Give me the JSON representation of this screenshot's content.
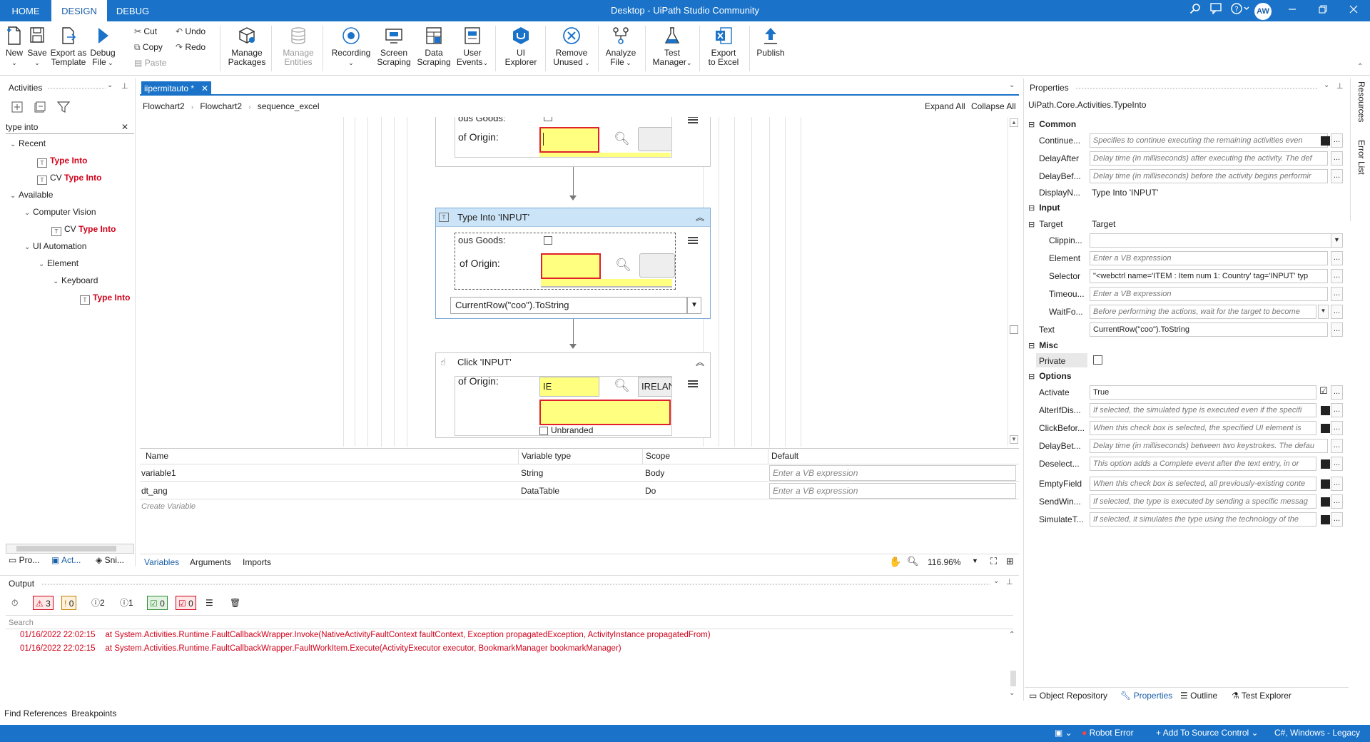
{
  "app": {
    "title": "Desktop - UiPath Studio Community",
    "tabs": [
      "HOME",
      "DESIGN",
      "DEBUG"
    ],
    "user_initials": "AW"
  },
  "ribbon": {
    "new": "New",
    "save": "Save",
    "export_template_1": "Export as",
    "export_template_2": "Template",
    "debug_1": "Debug",
    "debug_2": "File",
    "cut": "Cut",
    "copy": "Copy",
    "paste": "Paste",
    "undo": "Undo",
    "redo": "Redo",
    "manage_packages_1": "Manage",
    "manage_packages_2": "Packages",
    "manage_entities_1": "Manage",
    "manage_entities_2": "Entities",
    "recording": "Recording",
    "screen_scraping_1": "Screen",
    "screen_scraping_2": "Scraping",
    "data_scraping_1": "Data",
    "data_scraping_2": "Scraping",
    "user_events_1": "User",
    "user_events_2": "Events",
    "ui_explorer_1": "UI",
    "ui_explorer_2": "Explorer",
    "remove_unused_1": "Remove",
    "remove_unused_2": "Unused",
    "analyze_file_1": "Analyze",
    "analyze_file_2": "File",
    "test_manager_1": "Test",
    "test_manager_2": "Manager",
    "export_excel_1": "Export",
    "export_excel_2": "to Excel",
    "publish": "Publish"
  },
  "activities": {
    "title": "Activities",
    "search_value": "type into",
    "recent": "Recent",
    "r1_label": "Type Into",
    "r2_prefix": "CV",
    "r2_label": "Type Into",
    "available": "Available",
    "computer_vision": "Computer Vision",
    "cv_prefix": "CV",
    "cv_label": "Type Into",
    "ui_automation": "UI Automation",
    "element": "Element",
    "keyboard": "Keyboard",
    "kb_label": "Type Into",
    "bottom_tabs": [
      "Pro...",
      "Act...",
      "Sni..."
    ]
  },
  "designer": {
    "doc_tab": "iipermitauto *",
    "breadcrumb": [
      "Flowchart2",
      "Flowchart2",
      "sequence_excel"
    ],
    "expand_all": "Expand All",
    "collapse_all": "Collapse All",
    "top_frag": {
      "goods": "ous Goods:",
      "origin": "of Origin:"
    },
    "type_into": {
      "title": "Type Into 'INPUT'",
      "goods": "ous Goods:",
      "origin": "of Origin:",
      "text": "CurrentRow(\"coo\").ToString"
    },
    "click": {
      "title": "Click 'INPUT'",
      "origin": "of Origin:",
      "ie": "IE",
      "irelan": "IRELAN",
      "unbranded": "Unbranded"
    }
  },
  "variables": {
    "headers": [
      "Name",
      "Variable type",
      "Scope",
      "Default"
    ],
    "rows": [
      {
        "name": "variable1",
        "type": "String",
        "scope": "Body",
        "default": "Enter a VB expression"
      },
      {
        "name": "dt_ang",
        "type": "DataTable",
        "scope": "Do",
        "default": "Enter a VB expression"
      }
    ],
    "create": "Create Variable",
    "tabs": [
      "Variables",
      "Arguments",
      "Imports"
    ],
    "zoom": "116.96%"
  },
  "output": {
    "title": "Output",
    "search_placeholder": "Search",
    "counts": {
      "errors": "3",
      "warnings": "0",
      "info": "2",
      "trace": "1",
      "success": "0",
      "fail": "0"
    },
    "lines": [
      {
        "time": "01/16/2022 22:02:15",
        "msg": "at System.Activities.Runtime.FaultCallbackWrapper.Invoke(NativeActivityFaultContext faultContext, Exception propagatedException, ActivityInstance propagatedFrom)"
      },
      {
        "time": "01/16/2022 22:02:15",
        "msg": "at System.Activities.Runtime.FaultCallbackWrapper.FaultWorkItem.Execute(ActivityExecutor executor, BookmarkManager bookmarkManager)"
      }
    ],
    "bottom_tabs": [
      "Find References",
      "Breakpoints"
    ]
  },
  "properties": {
    "title": "Properties",
    "type": "UiPath.Core.Activities.TypeInto",
    "common": "Common",
    "input": "Input",
    "misc": "Misc",
    "options": "Options",
    "continue_label": "Continue...",
    "continue_val": "Specifies to continue executing the remaining activities even",
    "delayafter_label": "DelayAfter",
    "delayafter_val": "Delay time (in milliseconds) after executing the activity. The def",
    "delaybef_label": "DelayBef...",
    "delaybef_val": "Delay time (in milliseconds) before the activity begins performir",
    "display_label": "DisplayN...",
    "display_val": "Type Into 'INPUT'",
    "target_label": "Target",
    "target_val": "Target",
    "clipping_label": "Clippin...",
    "element_label": "Element",
    "element_val": "Enter a VB expression",
    "selector_label": "Selector",
    "selector_val": "\"<webctrl name='ITEM : Item num 1: Country' tag='INPUT' typ",
    "timeout_label": "Timeou...",
    "timeout_val": "Enter a VB expression",
    "waitfo_label": "WaitFo...",
    "waitfo_val": "Before performing the actions, wait for the target to become",
    "text_label": "Text",
    "text_val": "CurrentRow(\"coo\").ToString",
    "private_label": "Private",
    "activate_label": "Activate",
    "activate_val": "True",
    "alter_label": "AlterIfDis...",
    "alter_val": "If selected, the simulated type is executed even if the specifi",
    "clickbefor_label": "ClickBefor...",
    "clickbefor_val": "When this check box is selected, the specified UI element is",
    "delaybet_label": "DelayBet...",
    "delaybet_val": "Delay time (in milliseconds) between two keystrokes. The defau",
    "deselect_label": "Deselect...",
    "deselect_val": "This option adds a Complete event after the text entry, in or",
    "emptyfield_label": "EmptyField",
    "emptyfield_val": "When this check box is selected, all previously-existing conte",
    "sendwin_label": "SendWin...",
    "sendwin_val": "If selected, the type is executed by sending a specific messag",
    "simulate_label": "SimulateT...",
    "simulate_val": "If selected, it simulates the type using the technology of the",
    "bottom_tabs": [
      "Object Repository",
      "Properties",
      "Outline",
      "Test Explorer"
    ],
    "side_tabs": [
      "Resources",
      "Error List"
    ]
  },
  "status": {
    "robot_error": "Robot Error",
    "source_control": "Add To Source Control",
    "env": "C#, Windows - Legacy"
  }
}
